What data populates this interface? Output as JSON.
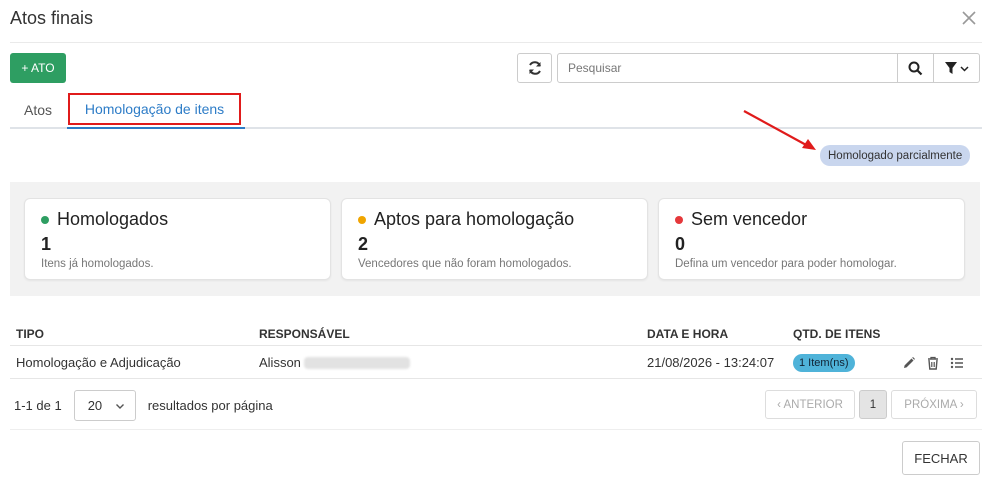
{
  "dialog": {
    "title": "Atos finais"
  },
  "toolbar": {
    "add_label": "+ ATO"
  },
  "search": {
    "placeholder": "Pesquisar"
  },
  "tabs": [
    {
      "label": "Atos",
      "active": false
    },
    {
      "label": "Homologação de itens",
      "active": true
    }
  ],
  "annotation": {
    "badge_label": "Homologado parcialmente"
  },
  "cards": [
    {
      "title": "Homologados",
      "count": "1",
      "desc": "Itens já homologados.",
      "dot_color": "#2e9e62"
    },
    {
      "title": "Aptos para homologação",
      "count": "2",
      "desc": "Vencedores que não foram homologados.",
      "dot_color": "#f0a500"
    },
    {
      "title": "Sem vencedor",
      "count": "0",
      "desc": "Defina um vencedor para poder homologar.",
      "dot_color": "#e5383b"
    }
  ],
  "table": {
    "headers": [
      "TIPO",
      "RESPONSÁVEL",
      "DATA E HORA",
      "QTD. DE ITENS"
    ],
    "rows": [
      {
        "tipo": "Homologação e Adjudicação",
        "responsavel": "Alisson",
        "data_hora": "21/08/2026 - 13:24:07",
        "qtd": "1 Item(ns)"
      }
    ]
  },
  "pagination": {
    "range": "1-1 de 1",
    "page_size": "20",
    "per_page_label": "resultados por página",
    "prev_label": "‹ ANTERIOR",
    "current_page": "1",
    "next_label": "PRÓXIMA ›"
  },
  "footer": {
    "close_label": "FECHAR"
  },
  "colors": {
    "primary_green": "#2e9e62",
    "tab_blue": "#2d7cc7",
    "highlight_red": "#e01b1b",
    "badge_blue": "#4fb3d9"
  }
}
